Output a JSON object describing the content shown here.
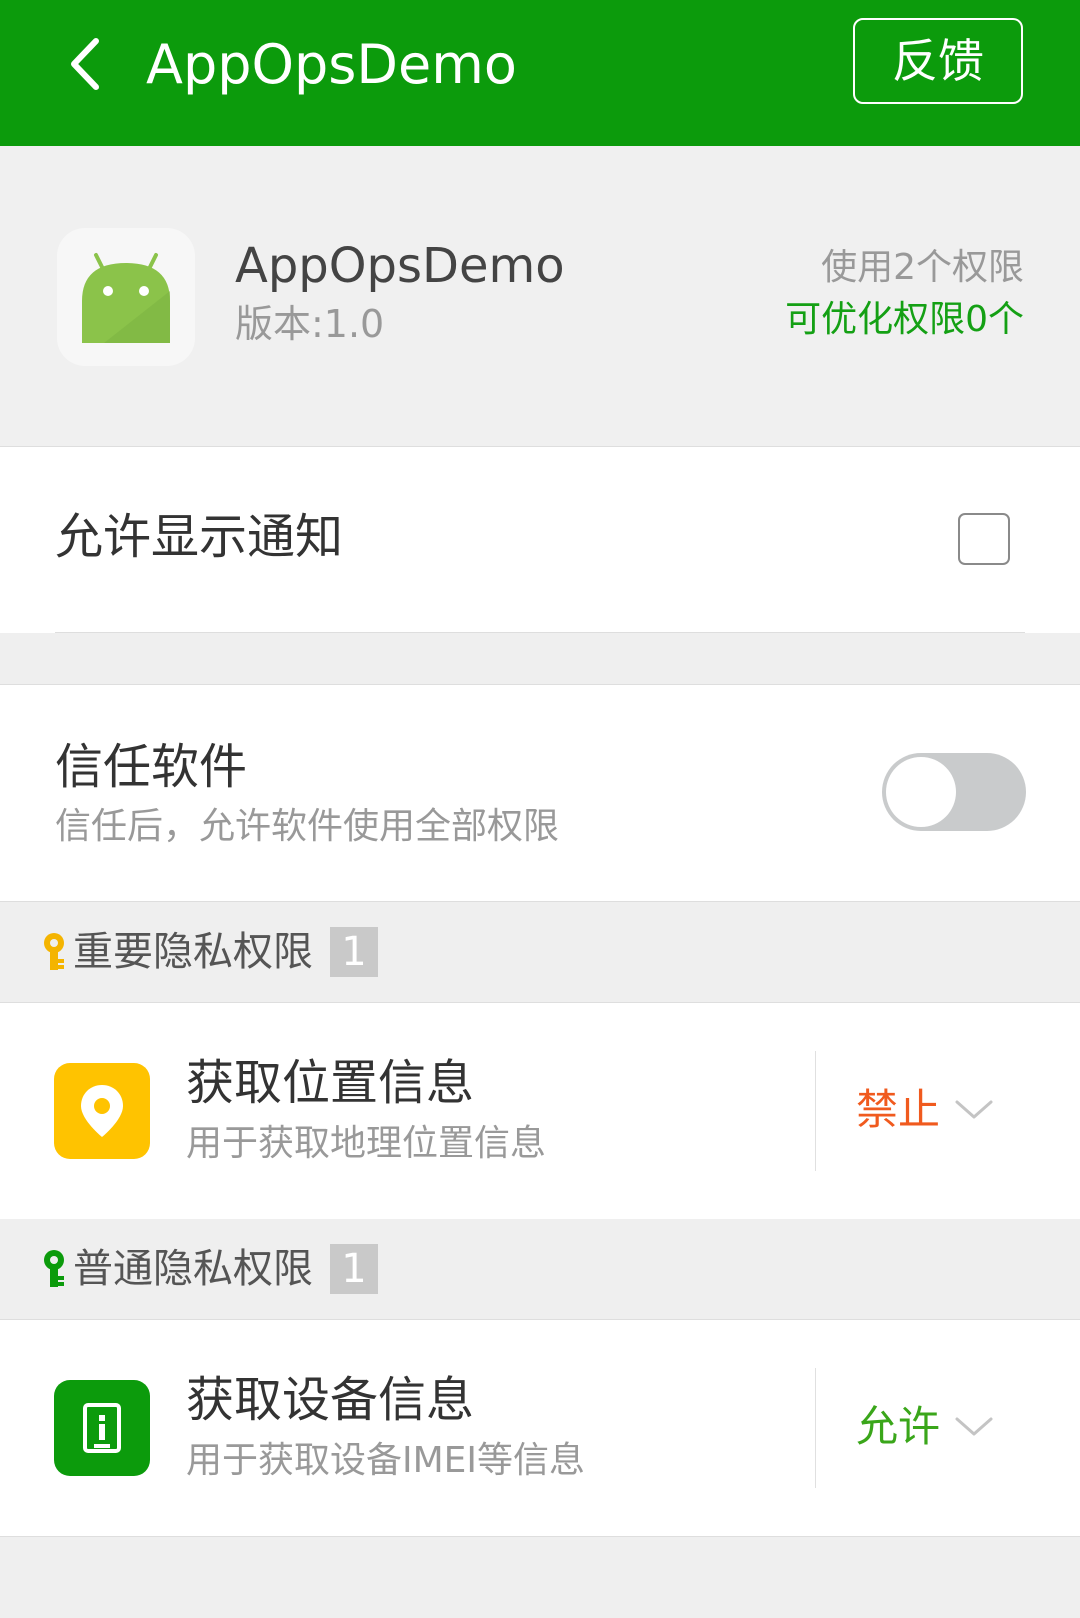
{
  "header": {
    "title": "AppOpsDemo",
    "back_icon": "chevron-left-icon",
    "feedback_label": "反馈",
    "bg_color": "#0c9b0c"
  },
  "app": {
    "name": "AppOpsDemo",
    "version": "版本:1.0",
    "icon": "android-icon",
    "permissions_used": "使用2个权限",
    "permissions_optimizable": "可优化权限0个"
  },
  "notification": {
    "label": "允许显示通知",
    "checked": false
  },
  "trust": {
    "label": "信任软件",
    "description": "信任后，允许软件使用全部权限",
    "enabled": false
  },
  "sections": [
    {
      "title": "重要隐私权限",
      "count": "1",
      "key_color": "#f4b400",
      "items": [
        {
          "name": "获取位置信息",
          "description": "用于获取地理位置信息",
          "icon": "location-pin-icon",
          "icon_bg": "#ffc300",
          "status": "禁止",
          "status_color": "#f05a1e"
        }
      ]
    },
    {
      "title": "普通隐私权限",
      "count": "1",
      "key_color": "#0c9b0c",
      "items": [
        {
          "name": "获取设备信息",
          "description": "用于获取设备IMEI等信息",
          "icon": "device-info-icon",
          "icon_bg": "#0c9b0c",
          "status": "允许",
          "status_color": "#3aa61a"
        }
      ]
    }
  ]
}
